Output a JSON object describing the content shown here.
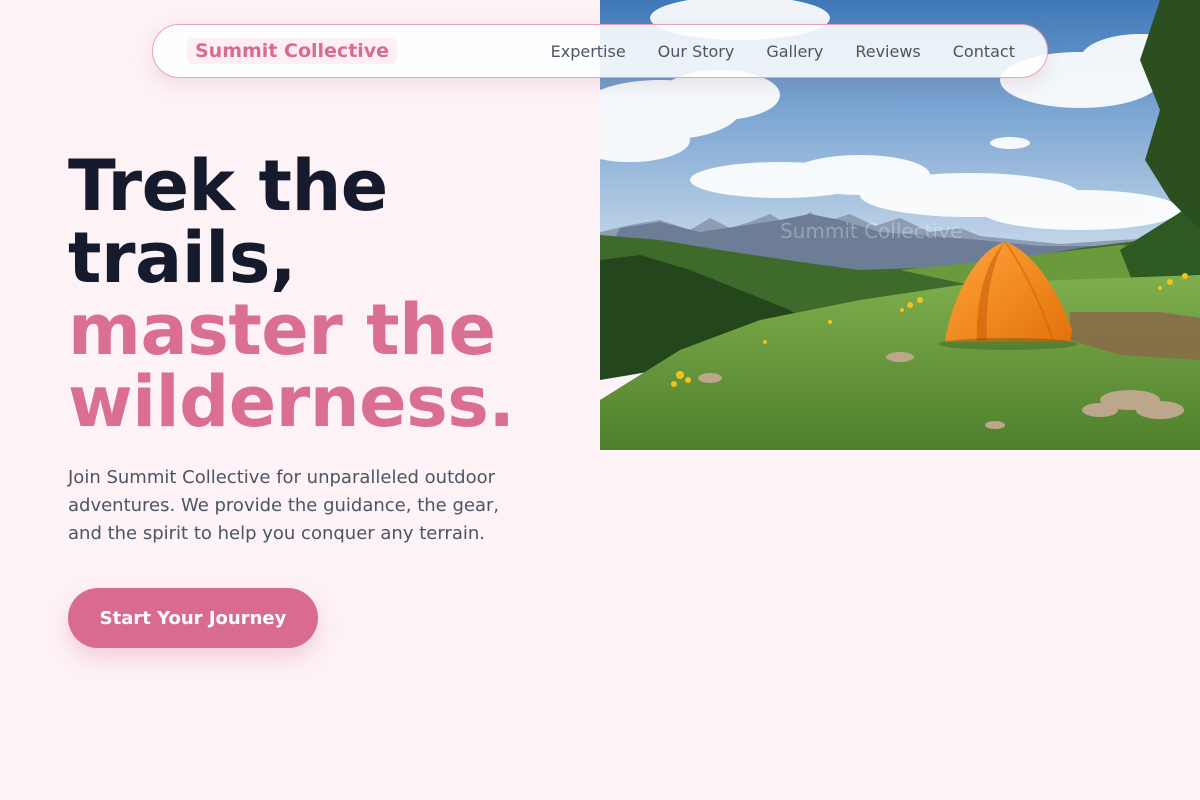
{
  "nav": {
    "brand": "Summit Collective",
    "links": [
      "Expertise",
      "Our Story",
      "Gallery",
      "Reviews",
      "Contact"
    ]
  },
  "hero": {
    "headline_line1": "Trek the",
    "headline_line2": "trails,",
    "headline_line3": "master the",
    "headline_line4": "wilderness.",
    "lead": "Join Summit Collective for unparalleled outdoor adventures. We provide the guidance, the gear, and the spirit to help you conquer any terrain.",
    "cta_label": "Start Your Journey",
    "image_watermark": "Summit Collective"
  },
  "colors": {
    "background": "#fdf2f5",
    "accent": "#d96b93",
    "heading": "#151a2d",
    "body_text": "#4b5563"
  }
}
